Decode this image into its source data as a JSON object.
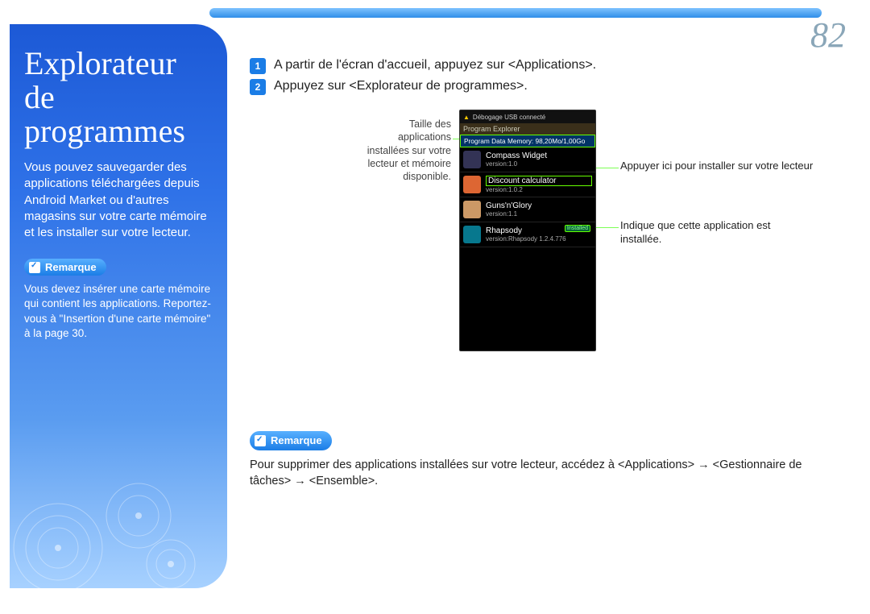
{
  "page_number": "82",
  "sidebar": {
    "title": "Explorateur de programmes",
    "description": "Vous pouvez sauvegarder des applications téléchargées depuis Android Market ou d'autres magasins sur votre carte mémoire et les installer sur votre lecteur.",
    "remark_label": "Remarque",
    "note": "Vous devez insérer une carte mémoire qui contient les applications. Reportez-vous à \"Insertion d'une carte mémoire\" à la page 30."
  },
  "steps": [
    {
      "num": "1",
      "text": "A partir de l'écran d'accueil, appuyez sur <Applications>."
    },
    {
      "num": "2",
      "text": "Appuyez sur <Explorateur de programmes>."
    }
  ],
  "figure": {
    "left_caption": "Taille des applications installées sur votre lecteur et mémoire disponible.",
    "right_caption_top": "Appuyer ici pour installer sur votre lecteur",
    "right_caption_bottom": "Indique que cette application est installée.",
    "phone": {
      "status_text": "Débogage USB connecté",
      "title_bar": "Program Explorer",
      "memory_bar": "Program Data Memory: 98,20Mo/1,00Go",
      "apps": [
        {
          "name": "Compass Widget",
          "version": "version:1.0",
          "installed_pill": ""
        },
        {
          "name": "Discount calculator",
          "version": "version:1.0.2",
          "installed_pill": ""
        },
        {
          "name": "Guns'n'Glory",
          "version": "version:1.1",
          "installed_pill": ""
        },
        {
          "name": "Rhapsody",
          "version": "version:Rhapsody 1.2.4.776",
          "installed_pill": "Installed"
        }
      ]
    }
  },
  "bottom_remark": {
    "label": "Remarque",
    "text": "Pour supprimer des applications installées sur votre lecteur, accédez à <Applications> → <Gestionnaire de tâches> → <Ensemble>."
  }
}
